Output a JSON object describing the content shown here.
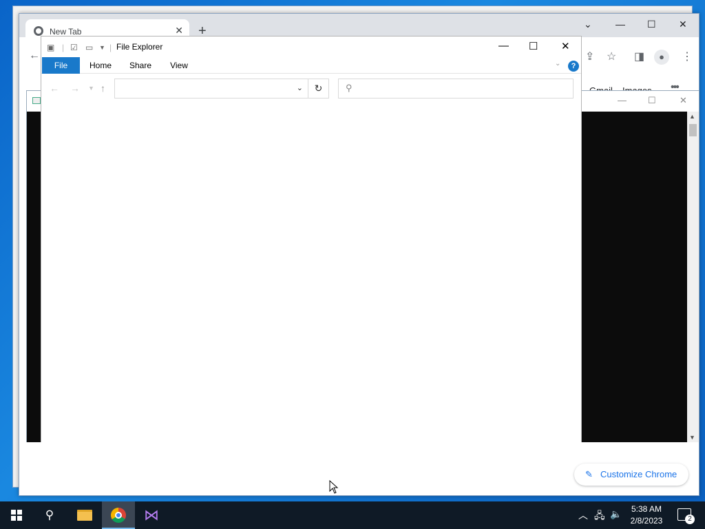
{
  "chrome": {
    "tab_title": "New Tab",
    "tab_close": "✕",
    "new_tab": "+",
    "window_controls": {
      "dropdown": "⌄",
      "minimize": "—",
      "maximize": "☐",
      "close": "✕"
    },
    "ntp_links": [
      "Gmail",
      "Images"
    ],
    "apps_icon": "•••",
    "customize_label": "Customize Chrome",
    "pencil_icon": "✎"
  },
  "dark_window": {
    "controls": {
      "minimize": "—",
      "maximize": "☐",
      "close": "✕"
    }
  },
  "explorer": {
    "title": "File Explorer",
    "ribbon_tabs": [
      "File",
      "Home",
      "Share",
      "View"
    ],
    "help": "?",
    "controls": {
      "minimize": "—",
      "maximize": "☐",
      "close": "✕"
    },
    "address_value": "",
    "search_placeholder": ""
  },
  "taskbar": {
    "time": "5:38 AM",
    "date": "2/8/2023",
    "notification_count": "2",
    "apps": [
      "start-button",
      "search-button",
      "file-explorer",
      "google-chrome",
      "visual-studio"
    ]
  },
  "colors": {
    "explorer_file_tab": "#1979ca",
    "taskbar": "#0f1a26",
    "desktop": "#0a64c8",
    "customize_text": "#1a73e8"
  }
}
